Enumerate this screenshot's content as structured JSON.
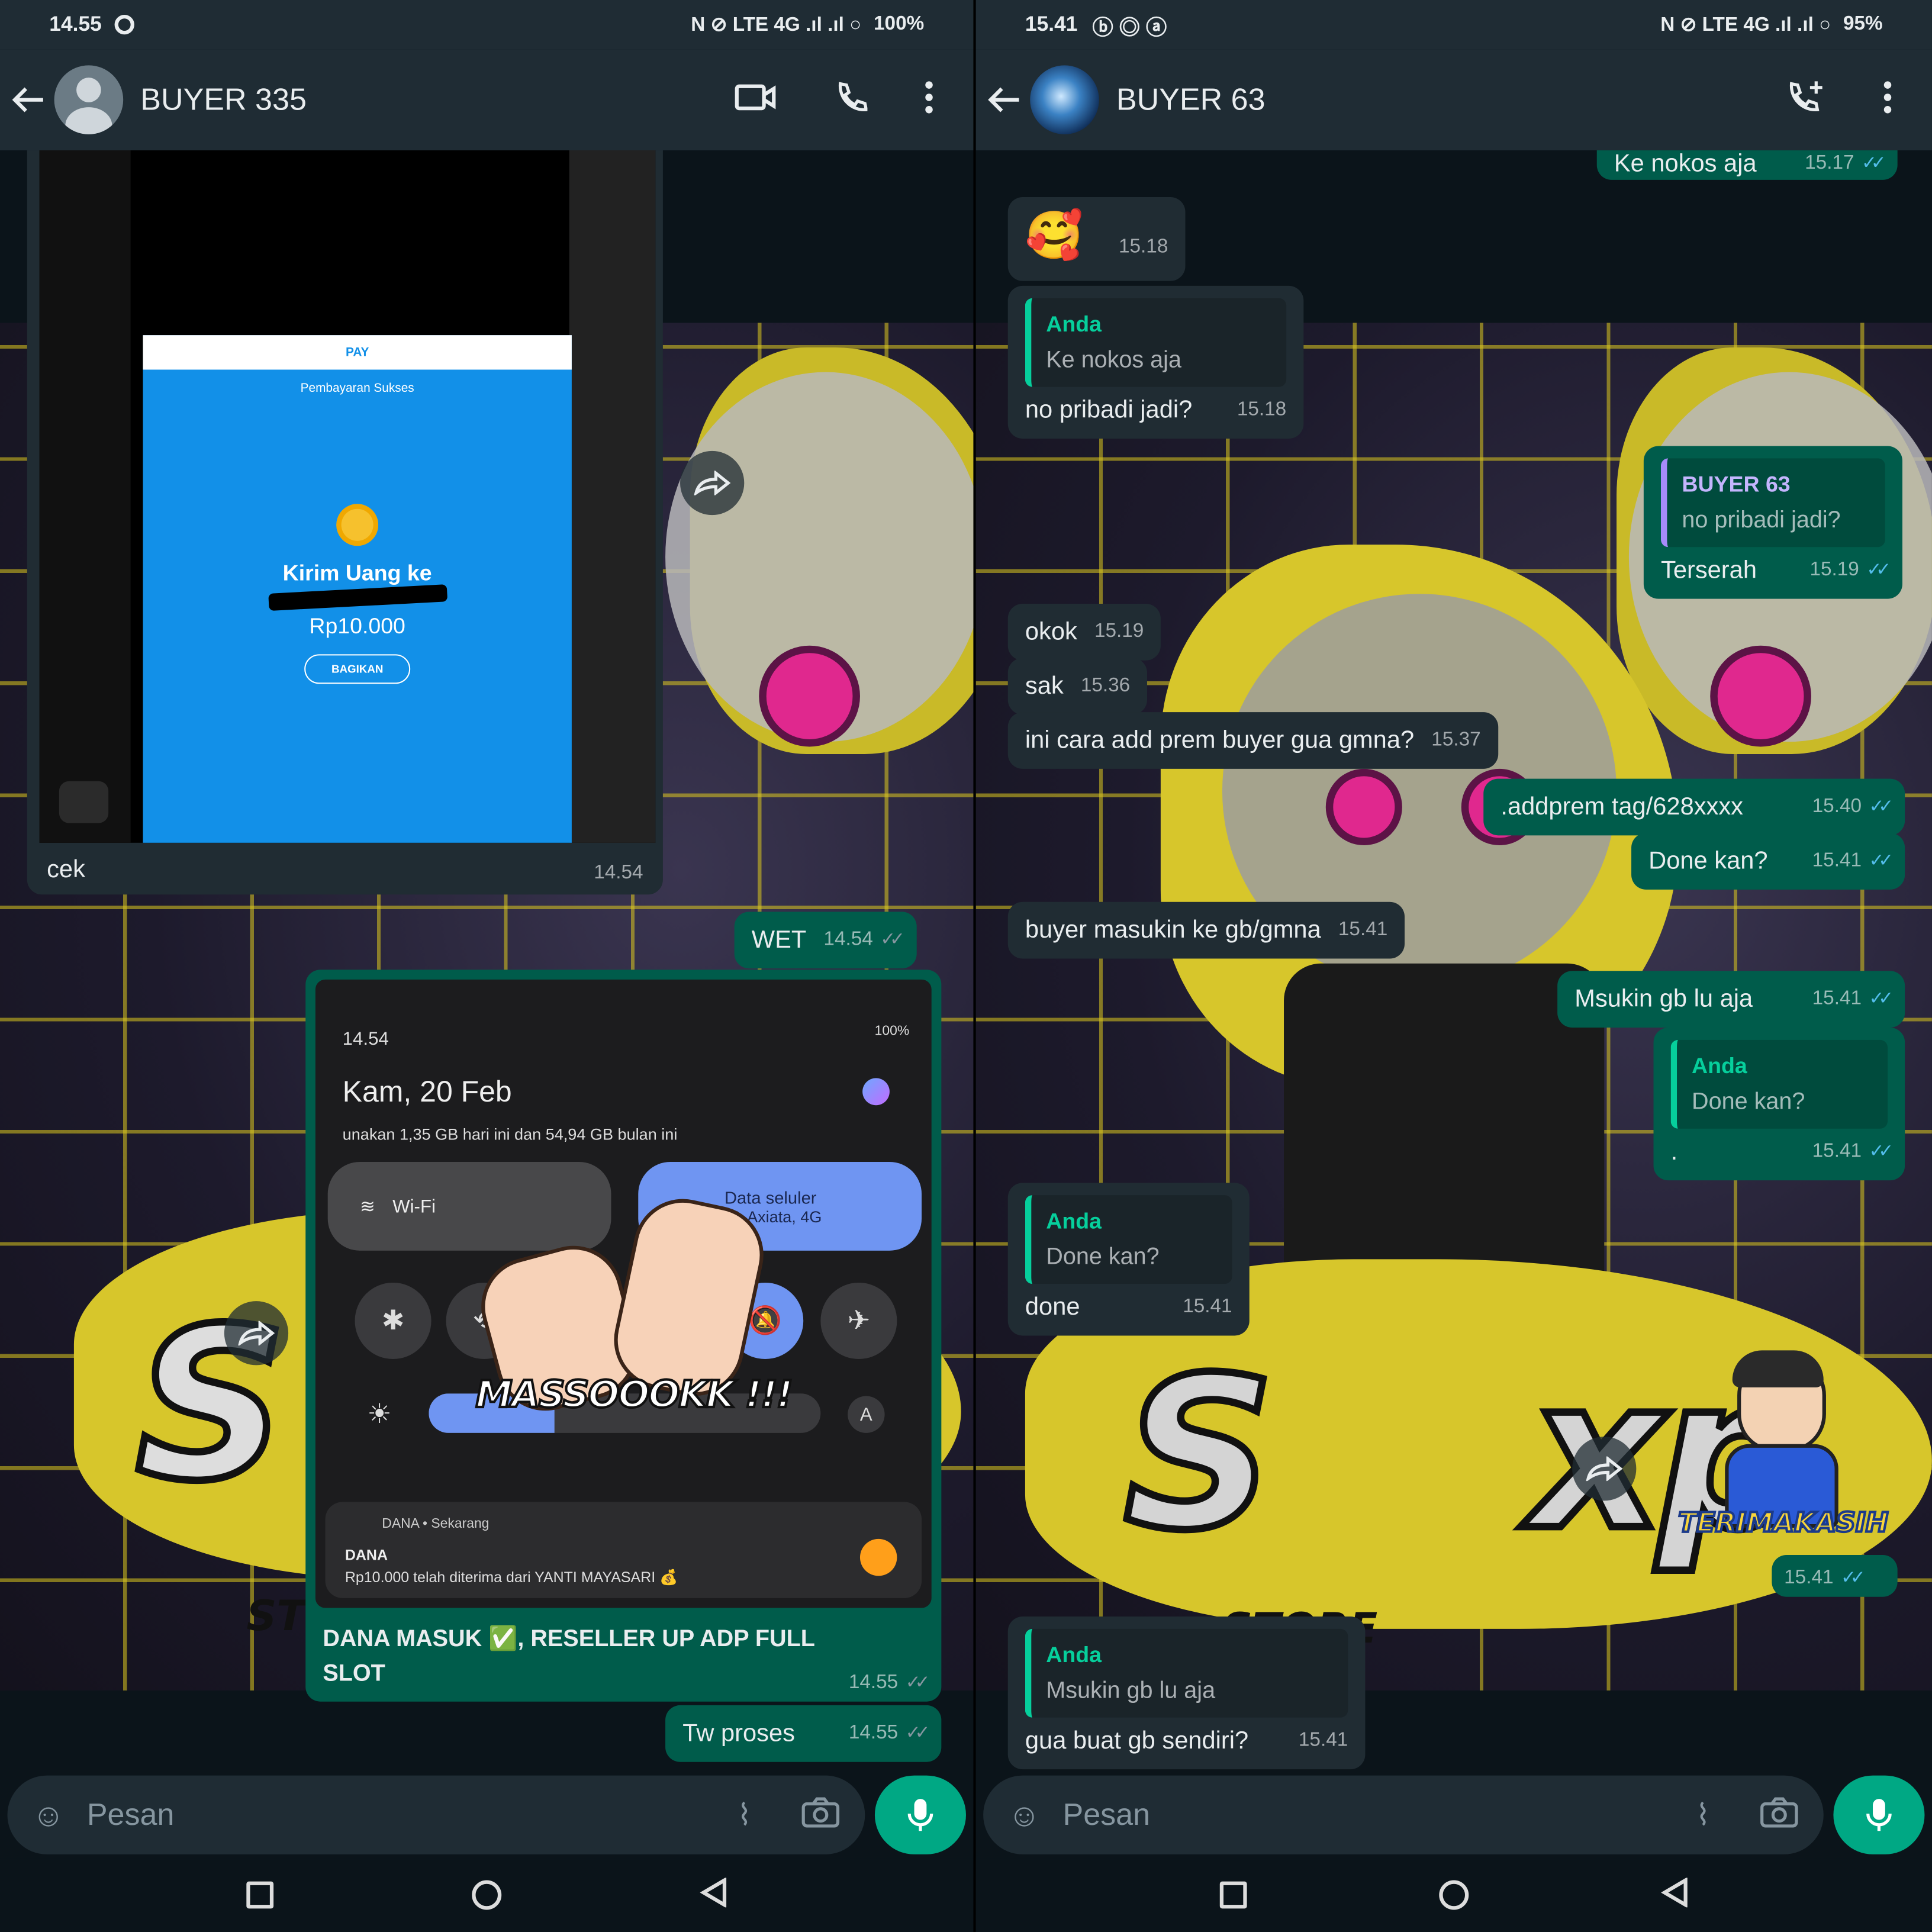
{
  "left": {
    "status": {
      "time": "14.55",
      "right": "100%"
    },
    "header": {
      "name": "BUYER 335"
    },
    "image_message": {
      "dana_header": "PAY",
      "dana_status": "Pembayaran Sukses",
      "dana_title": "Kirim Uang ke",
      "dana_amount": "Rp10.000",
      "dana_share": "BAGIKAN",
      "caption": "cek",
      "time": "14.54"
    },
    "wet": {
      "text": "WET",
      "time": "14.54"
    },
    "qs_message": {
      "status_time": "14.54",
      "status_right": "100%",
      "date": "Kam, 20 Feb",
      "usage": "unakan 1,35 GB hari ini dan 54,94 GB bulan ini",
      "wifi": "Wi-Fi",
      "data_title": "Data seluler",
      "data_sub": "XL Axiata, 4G",
      "auto": "A",
      "sticker": "MASSOOOKK !!!",
      "notif_source": "DANA • Sekarang",
      "notif_title": "DANA",
      "notif_body": "Rp10.000 telah diterima dari YANTI MAYASARI 💰",
      "caption": "DANA MASUK ✅, RESELLER UP ADP FULL SLOT",
      "time": "14.55"
    },
    "last": {
      "text": "Tw proses",
      "time": "14.55"
    },
    "input_placeholder": "Pesan"
  },
  "right": {
    "status": {
      "time": "15.41",
      "right": "95%"
    },
    "header": {
      "name": "BUYER 63"
    },
    "messages": {
      "top_partial": {
        "text": "Ke nokos aja",
        "time": "15.17"
      },
      "emoji": {
        "text": "🥰",
        "time": "15.18"
      },
      "reply1": {
        "qname": "Anda",
        "qtext": "Ke nokos aja",
        "text": "no pribadi jadi?",
        "time": "15.18"
      },
      "reply2": {
        "qname": "BUYER 63",
        "qtext": "no pribadi jadi?",
        "text": "Terserah",
        "time": "15.19"
      },
      "okok": {
        "text": "okok",
        "time": "15.19"
      },
      "sak": {
        "text": "sak",
        "time": "15.36"
      },
      "cara": {
        "text": "ini cara add prem buyer gua gmna?",
        "time": "15.37"
      },
      "addprem": {
        "text": ".addprem tag/628xxxx",
        "time": "15.40"
      },
      "done_q": {
        "text": "Done kan?",
        "time": "15.41"
      },
      "buyer_gb": {
        "text": "buyer masukin ke gb/gmna",
        "time": "15.41"
      },
      "msukin": {
        "text": "Msukin gb lu aja",
        "time": "15.41"
      },
      "reply3": {
        "qname": "Anda",
        "qtext": "Done kan?",
        "text": ".",
        "time": "15.41"
      },
      "reply4": {
        "qname": "Anda",
        "qtext": "Done kan?",
        "text": "done",
        "time": "15.41"
      },
      "sticker": {
        "text": "TERIMAKASIH",
        "time": "15.41"
      },
      "reply5": {
        "qname": "Anda",
        "qtext": "Msukin gb lu aja",
        "text": "gua buat gb sendiri?",
        "time": "15.41"
      }
    },
    "input_placeholder": "Pesan"
  },
  "wallpaper": {
    "store": "STORE"
  },
  "colors": {
    "outgoing": "#005c4b",
    "incoming": "#202c33",
    "accent": "#00a884",
    "read_ticks": "#53bdeb"
  }
}
